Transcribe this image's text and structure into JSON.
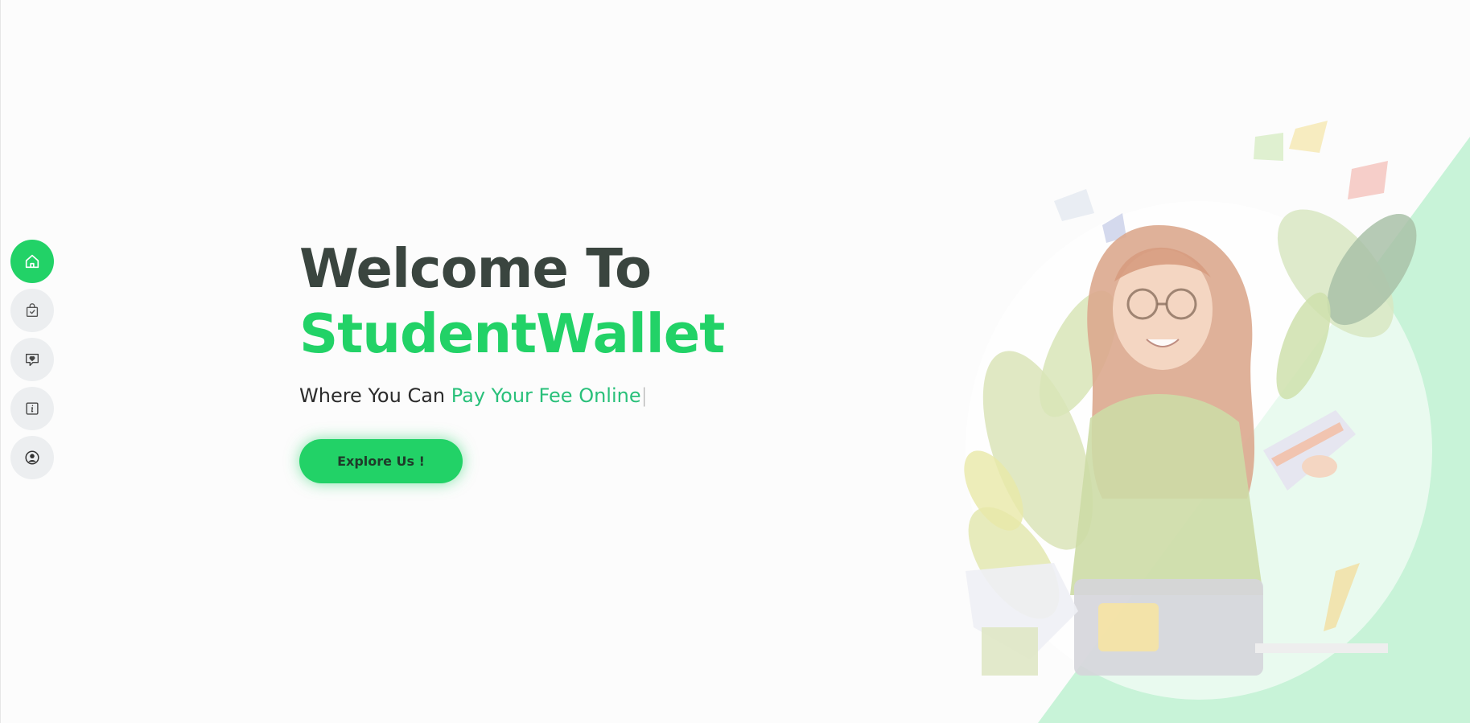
{
  "sidebar": {
    "items": [
      {
        "icon": "home-icon",
        "active": true
      },
      {
        "icon": "shopping-bag-icon",
        "active": false
      },
      {
        "icon": "heart-message-icon",
        "active": false
      },
      {
        "icon": "info-icon",
        "active": false
      },
      {
        "icon": "user-icon",
        "active": false
      }
    ]
  },
  "hero": {
    "title_line1": "Welcome To",
    "title_line2": "StudentWallet",
    "subtitle_prefix": "Where You Can ",
    "subtitle_highlight": "Pay Your Fee Online",
    "cursor": "|",
    "cta_label": "Explore Us !"
  },
  "colors": {
    "accent": "#22d267",
    "title_dark": "#3a453f",
    "subtitle_highlight": "#29c07a",
    "nav_inactive": "#eceef0"
  }
}
